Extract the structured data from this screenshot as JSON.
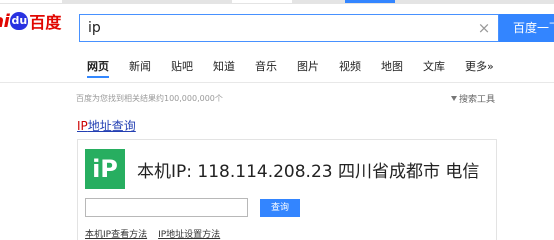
{
  "logo": {
    "part1": "ai",
    "paw": "du",
    "part2": "百度"
  },
  "search": {
    "value": "ip",
    "button_label": "百度一下"
  },
  "tabs": [
    "网页",
    "新闻",
    "贴吧",
    "知道",
    "音乐",
    "图片",
    "视频",
    "地图",
    "文库",
    "更多»"
  ],
  "result_stats": "百度为您找到相关结果约100,000,000个",
  "search_tools_label": "搜索工具",
  "result": {
    "title_highlight": "IP",
    "title_rest": "地址查询",
    "icon_text": "iP",
    "ip_info": "本机IP: 118.114.208.23  四川省成都市 电信",
    "query_button": "查询",
    "links": [
      "本机IP查看方法",
      "IP地址设置方法"
    ]
  },
  "colors": {
    "brand_red": "#e10601",
    "brand_blue": "#3385ff",
    "ip_icon_green": "#27ae60",
    "link": "#2440b3"
  }
}
